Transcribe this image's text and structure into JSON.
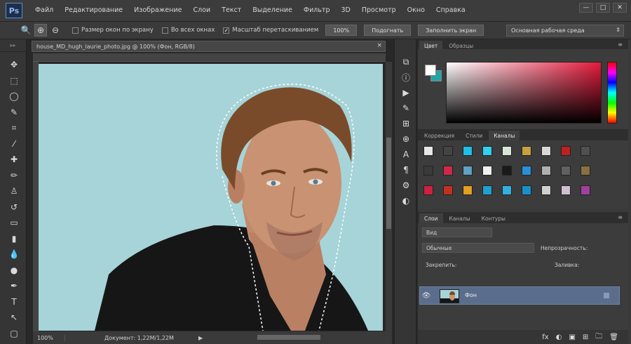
{
  "app": {
    "logo": "Ps",
    "menu": [
      "Файл",
      "Редактирование",
      "Изображение",
      "Слои",
      "Текст",
      "Выделение",
      "Фильтр",
      "3D",
      "Просмотр",
      "Окно",
      "Справка"
    ],
    "window_controls": [
      "—",
      "□",
      "✕"
    ]
  },
  "options_bar": {
    "resize_windows_label": "Размер окон по экрану",
    "all_windows_label": "Во всех окнах",
    "scrubby_zoom_label": "Масштаб перетаскиванием",
    "btn_100": "100%",
    "btn_fit": "Подогнать",
    "btn_fill": "Заполнить экран",
    "workspace": "Основная рабочая среда"
  },
  "document": {
    "tab_title": "house_MD_hugh_laurie_photo.jpg @ 100% (Фон, RGB/8)",
    "zoom": "100%",
    "status": "Документ: 1,22M/1,22M",
    "close_glyph": "×"
  },
  "tools": [
    {
      "name": "move-tool-icon",
      "glyph": "✥"
    },
    {
      "name": "marquee-tool-icon",
      "glyph": "⬚"
    },
    {
      "name": "lasso-tool-icon",
      "glyph": "◯"
    },
    {
      "name": "quick-select-tool-icon",
      "glyph": "✎"
    },
    {
      "name": "crop-tool-icon",
      "glyph": "⌗"
    },
    {
      "name": "eyedropper-tool-icon",
      "glyph": "⁄"
    },
    {
      "name": "healing-brush-tool-icon",
      "glyph": "✚"
    },
    {
      "name": "brush-tool-icon",
      "glyph": "✏"
    },
    {
      "name": "stamp-tool-icon",
      "glyph": "♙"
    },
    {
      "name": "history-brush-tool-icon",
      "glyph": "↺"
    },
    {
      "name": "eraser-tool-icon",
      "glyph": "▭"
    },
    {
      "name": "gradient-tool-icon",
      "glyph": "▮"
    },
    {
      "name": "blur-tool-icon",
      "glyph": "💧"
    },
    {
      "name": "dodge-tool-icon",
      "glyph": "●"
    },
    {
      "name": "pen-tool-icon",
      "glyph": "✒"
    },
    {
      "name": "type-tool-icon",
      "glyph": "T"
    },
    {
      "name": "path-select-tool-icon",
      "glyph": "↖"
    },
    {
      "name": "shape-tool-icon",
      "glyph": "▢"
    }
  ],
  "strip_icons": [
    {
      "name": "history-panel-icon",
      "glyph": "⧉"
    },
    {
      "name": "info-panel-icon",
      "glyph": "ⓘ"
    },
    {
      "name": "actions-panel-icon",
      "glyph": "▶"
    },
    {
      "name": "brush-panel-icon",
      "glyph": "✎"
    },
    {
      "name": "brush-presets-icon",
      "glyph": "⊞"
    },
    {
      "name": "clone-source-icon",
      "glyph": "⊕"
    },
    {
      "name": "character-panel-icon",
      "glyph": "A"
    },
    {
      "name": "paragraph-panel-icon",
      "glyph": "¶"
    },
    {
      "name": "tool-presets-icon",
      "glyph": "⚙"
    },
    {
      "name": "adjustments-icon",
      "glyph": "◐"
    }
  ],
  "panels": {
    "color_tabs": [
      "Цвет",
      "Образцы"
    ],
    "style_tabs": [
      "Коррекция",
      "Стили",
      "Каналы"
    ],
    "layers_tabs": [
      "Слои",
      "Каналы",
      "Контуры"
    ],
    "menu_glyph": "≡",
    "kind_filter": "Вид",
    "blend_mode": "Обычные",
    "opacity_label": "Непрозрачность:",
    "lock_label": "Закрепить:",
    "fill_label": "Заливка:",
    "layer_name": "Фон",
    "footer_icons": [
      "fx",
      "◐",
      "▣",
      "⊞",
      "🗀",
      "🗑"
    ]
  },
  "colors": {
    "foreground": "#ffffff",
    "background": "#1fa7a5",
    "canvas_bg": "#a6d4d8"
  }
}
